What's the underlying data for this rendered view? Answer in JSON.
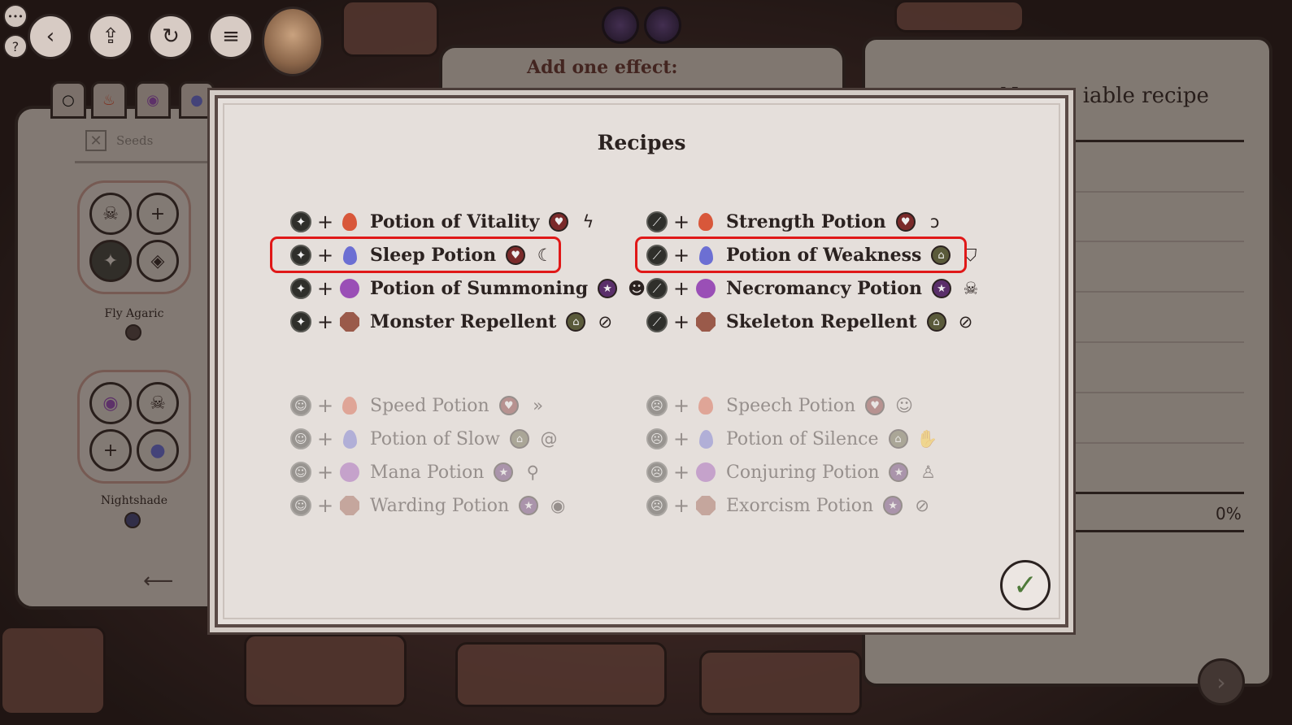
{
  "hud": {
    "menu_dots": "•••",
    "help": "?",
    "back_icon": "chevron-left-icon",
    "upload_icon": "upload-icon",
    "undo_icon": "undo-icon",
    "menu_icon": "hamburger-menu-icon",
    "back_glyph": "‹",
    "upload_glyph": "⇪",
    "undo_glyph": "↻",
    "menu_glyph": "≡"
  },
  "background": {
    "scroll_text": "Add one effect:",
    "right_title": "New ... iable recipe",
    "percent": "0%",
    "next_glyph": "›"
  },
  "left_book": {
    "tabs": [
      "○",
      "♨",
      "◉",
      "●"
    ],
    "seeds_label": "Seeds",
    "seeds_check": "✕",
    "ingredients": [
      {
        "name": "Fly Agaric",
        "slots": [
          "☠",
          "+",
          "✦",
          "◈"
        ],
        "dot_color": "#5a4a46"
      },
      {
        "name": "Nightshade",
        "slots": [
          "◉",
          "☠",
          "+",
          "●"
        ],
        "dot_color": "#4a4a7a"
      }
    ],
    "page_arrow": "⟵"
  },
  "modal": {
    "title": "Recipes",
    "confirm_glyph": "✓",
    "highlight_color": "#e01818"
  },
  "recipes_active": [
    {
      "effect": "✦",
      "element": "fire",
      "name": "Potion of Vitality",
      "prop": "♥",
      "prop_color": "#7a2a2a",
      "result": "ϟ"
    },
    {
      "effect": "✦",
      "element": "water",
      "name": "Sleep Potion",
      "prop": "♥",
      "prop_color": "#7a2a2a",
      "result": "☾"
    },
    {
      "effect": "✦",
      "element": "arcane",
      "name": "Potion of Summoning",
      "prop": "★",
      "prop_color": "#5a2f6a",
      "result": "☻"
    },
    {
      "effect": "✦",
      "element": "earth",
      "name": "Monster Repellent",
      "prop": "⌂",
      "prop_color": "#5a5a3a",
      "result": "⊘"
    },
    {
      "effect": "⟋",
      "element": "fire",
      "name": "Strength Potion",
      "prop": "♥",
      "prop_color": "#7a2a2a",
      "result": "ↄ"
    },
    {
      "effect": "⟋",
      "element": "water",
      "name": "Potion of Weakness",
      "prop": "⌂",
      "prop_color": "#5a5a3a",
      "result": "⛉"
    },
    {
      "effect": "⟋",
      "element": "arcane",
      "name": "Necromancy Potion",
      "prop": "★",
      "prop_color": "#5a2f6a",
      "result": "☠"
    },
    {
      "effect": "⟋",
      "element": "earth",
      "name": "Skeleton Repellent",
      "prop": "⌂",
      "prop_color": "#5a5a3a",
      "result": "⊘"
    }
  ],
  "recipes_locked": [
    {
      "effect": "☺",
      "element": "fire",
      "name": "Speed Potion",
      "prop": "♥",
      "prop_color": "#7a2a2a",
      "result": "»"
    },
    {
      "effect": "☺",
      "element": "water",
      "name": "Potion of Slow",
      "prop": "⌂",
      "prop_color": "#5a5a3a",
      "result": "@"
    },
    {
      "effect": "☺",
      "element": "arcane",
      "name": "Mana Potion",
      "prop": "★",
      "prop_color": "#5a2f6a",
      "result": "⚲"
    },
    {
      "effect": "☺",
      "element": "earth",
      "name": "Warding Potion",
      "prop": "★",
      "prop_color": "#5a2f6a",
      "result": "◉"
    },
    {
      "effect": "☹",
      "element": "fire",
      "name": "Speech Potion",
      "prop": "♥",
      "prop_color": "#7a2a2a",
      "result": "☺"
    },
    {
      "effect": "☹",
      "element": "water",
      "name": "Potion of Silence",
      "prop": "⌂",
      "prop_color": "#5a5a3a",
      "result": "✋"
    },
    {
      "effect": "☹",
      "element": "arcane",
      "name": "Conjuring Potion",
      "prop": "★",
      "prop_color": "#5a2f6a",
      "result": "♙"
    },
    {
      "effect": "☹",
      "element": "earth",
      "name": "Exorcism Potion",
      "prop": "★",
      "prop_color": "#5a2f6a",
      "result": "⊘"
    }
  ]
}
